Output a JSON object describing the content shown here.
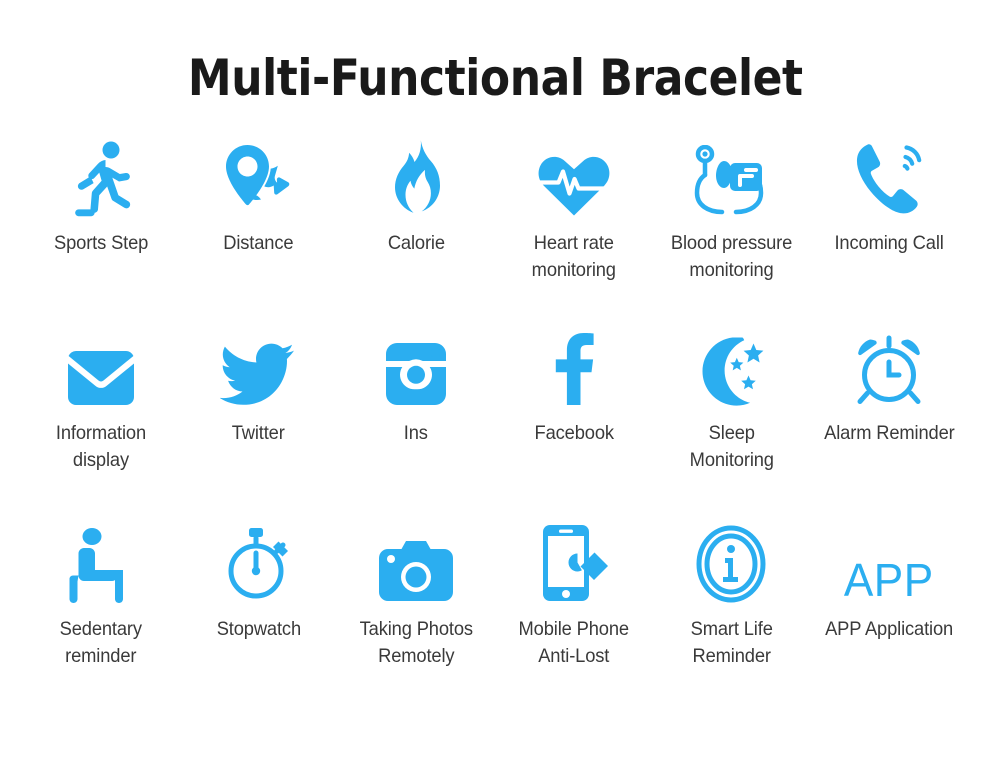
{
  "header": {
    "title": "Multi-Functional Bracelet"
  },
  "theme": {
    "accent_blue": "#2BAEF0",
    "label_color": "#3a3a3a",
    "title_color": "#1a1a1a",
    "background": "#ffffff"
  },
  "features": {
    "rows": [
      [
        {
          "icon": "running-person-icon",
          "label": "Sports Step"
        },
        {
          "icon": "location-pin-icon",
          "label": "Distance"
        },
        {
          "icon": "flame-icon",
          "label": "Calorie"
        },
        {
          "icon": "heart-pulse-icon",
          "label": "Heart rate\nmonitoring"
        },
        {
          "icon": "blood-pressure-monitor-icon",
          "label": "Blood pressure\nmonitoring"
        },
        {
          "icon": "incoming-call-icon",
          "label": "Incoming Call"
        }
      ],
      [
        {
          "icon": "envelope-icon",
          "label": "Information\ndisplay"
        },
        {
          "icon": "twitter-bird-icon",
          "label": "Twitter"
        },
        {
          "icon": "instagram-camera-icon",
          "label": "Ins"
        },
        {
          "icon": "facebook-f-icon",
          "label": "Facebook"
        },
        {
          "icon": "moon-stars-icon",
          "label": "Sleep\nMonitoring"
        },
        {
          "icon": "alarm-clock-icon",
          "label": "Alarm Reminder"
        }
      ],
      [
        {
          "icon": "sitting-person-icon",
          "label": "Sedentary\nreminder"
        },
        {
          "icon": "stopwatch-icon",
          "label": "Stopwatch"
        },
        {
          "icon": "camera-icon",
          "label": "Taking Photos\nRemotely"
        },
        {
          "icon": "phone-anti-lost-icon",
          "label": "Mobile Phone\nAnti-Lost"
        },
        {
          "icon": "info-circle-icon",
          "label": "Smart Life\nReminder"
        },
        {
          "icon": "app-wordmark",
          "label": "APP Application",
          "wordmark": "APP"
        }
      ]
    ]
  }
}
